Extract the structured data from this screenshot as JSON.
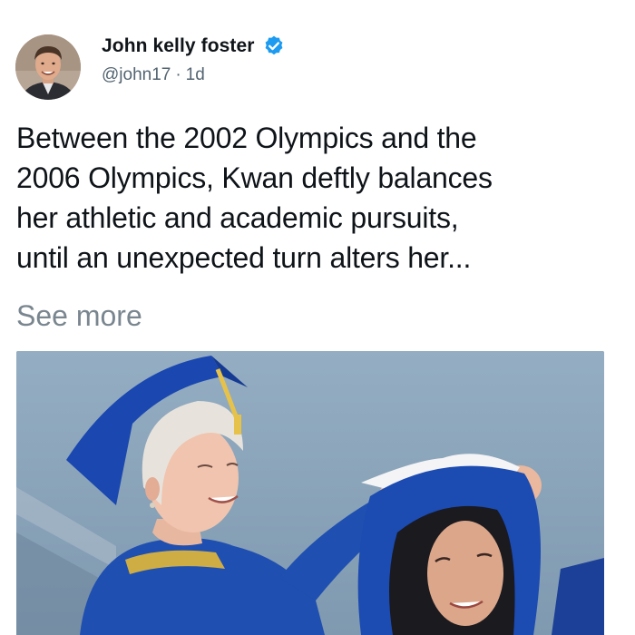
{
  "author": {
    "display_name": "John kelly foster",
    "handle": "@john17",
    "separator": "·",
    "time_ago": "1d",
    "verified": true,
    "verified_icon": "verified-badge-icon",
    "verified_color": "#1d9bf0"
  },
  "post": {
    "text_lines": [
      "Between the 2002 Olympics and the",
      "2006 Olympics, Kwan deftly balances",
      "her athletic and academic pursuits,",
      "until an unexpected turn alters her..."
    ],
    "see_more_label": "See more"
  },
  "colors": {
    "text": "#0f1419",
    "secondary_text": "#536471",
    "see_more": "#7a868f",
    "gown_blue": "#1f4fb0"
  }
}
